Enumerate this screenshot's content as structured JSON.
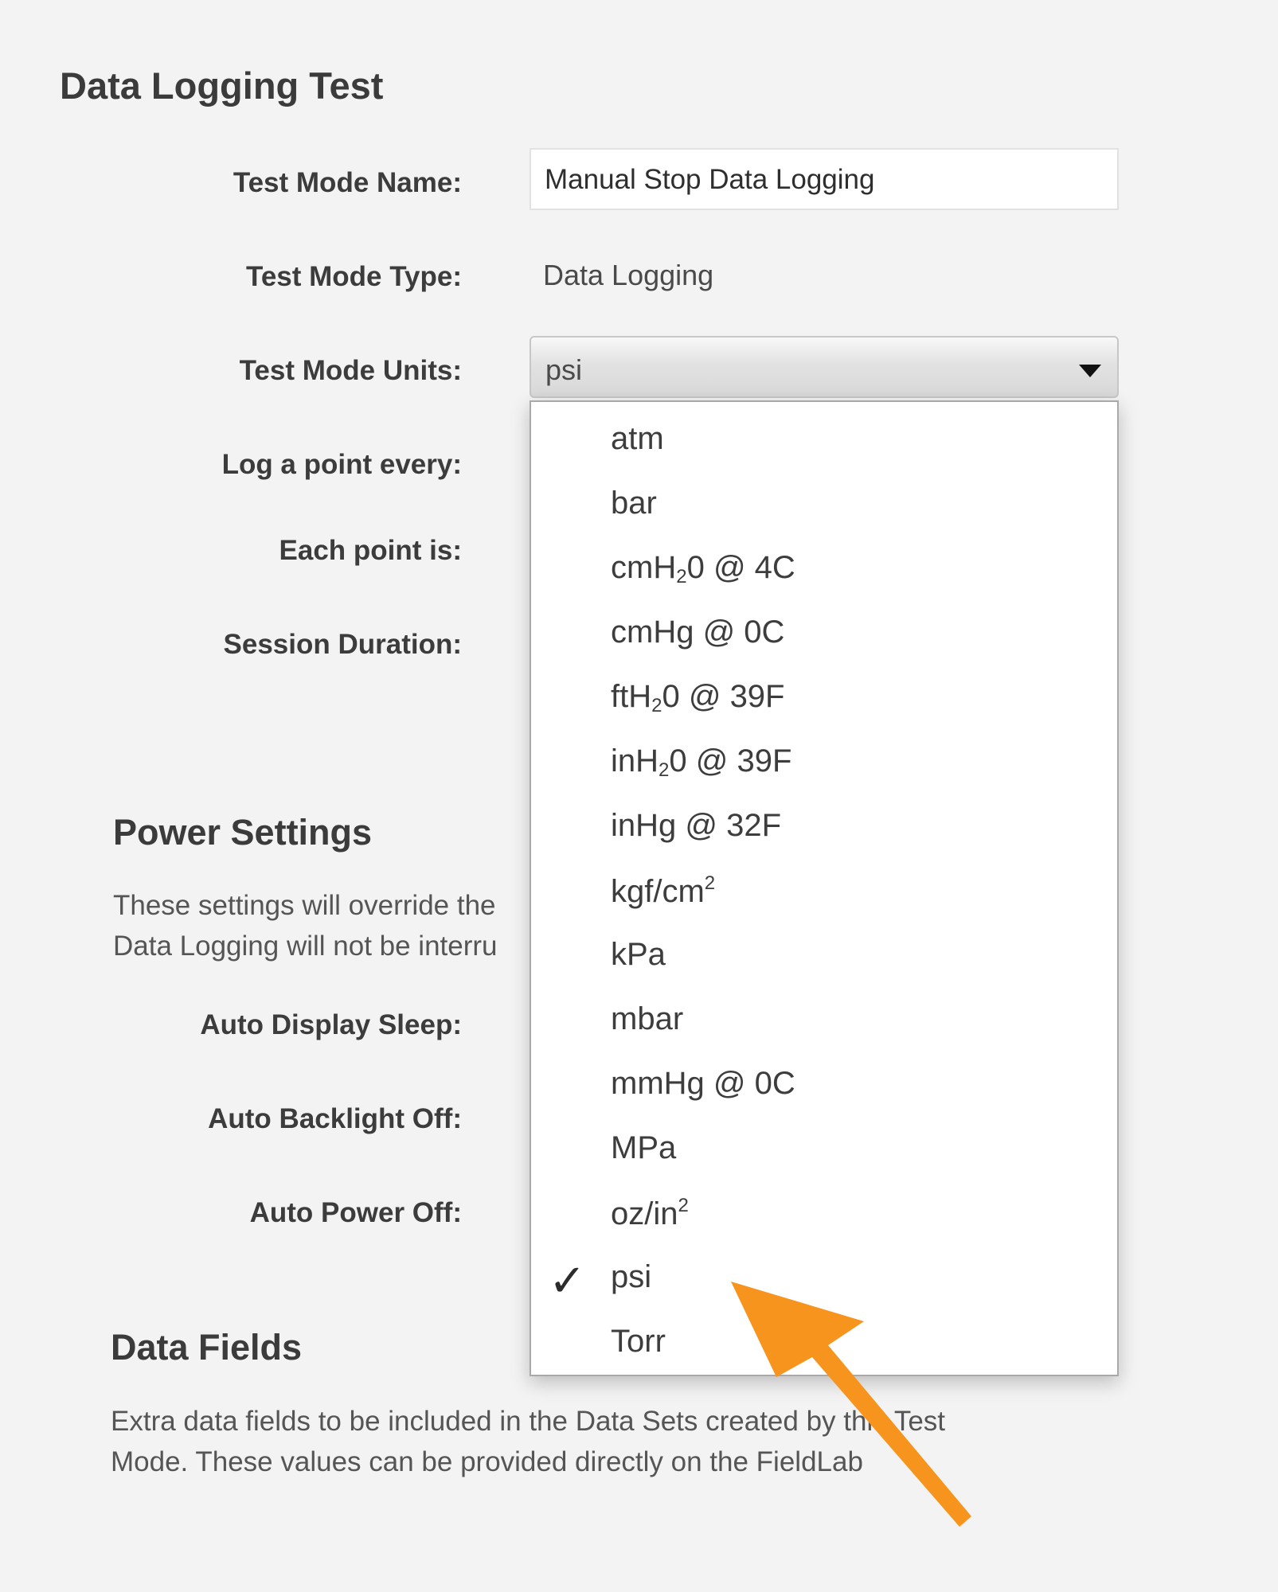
{
  "page": {
    "title": "Data Logging Test"
  },
  "form": {
    "test_mode_name": {
      "label": "Test Mode Name:",
      "value": "Manual Stop Data Logging"
    },
    "test_mode_type": {
      "label": "Test Mode Type:",
      "value": "Data Logging"
    },
    "test_mode_units": {
      "label": "Test Mode Units:",
      "selected": "psi"
    },
    "log_point_every": {
      "label": "Log a point every:"
    },
    "each_point_is": {
      "label": "Each point is:"
    },
    "session_duration": {
      "label": "Session Duration:"
    }
  },
  "power_settings": {
    "title": "Power Settings",
    "description_line1": "These settings will override the",
    "description_line2": "Data Logging will not be interru",
    "auto_display_sleep": {
      "label": "Auto Display Sleep:"
    },
    "auto_backlight_off": {
      "label": "Auto Backlight Off:"
    },
    "auto_power_off": {
      "label": "Auto Power Off:"
    }
  },
  "data_fields": {
    "title": "Data Fields",
    "description_line1": "Extra data fields to be included in the Data Sets created by this Test",
    "description_line2": "Mode. These values can be provided directly on the FieldLab"
  },
  "units_dropdown": {
    "options": [
      {
        "id": "atm",
        "base": "atm"
      },
      {
        "id": "bar",
        "base": "bar"
      },
      {
        "id": "cmh2o",
        "pre": "cmH",
        "sub": "2",
        "post": "0 @ 4C"
      },
      {
        "id": "cmhg",
        "base": "cmHg @ 0C"
      },
      {
        "id": "fth2o",
        "pre": "ftH",
        "sub": "2",
        "post": "0 @ 39F"
      },
      {
        "id": "inh2o",
        "pre": "inH",
        "sub": "2",
        "post": "0 @ 39F"
      },
      {
        "id": "inhg",
        "base": "inHg @ 32F"
      },
      {
        "id": "kgfcm2",
        "pre": "kgf/cm",
        "sup": "2"
      },
      {
        "id": "kpa",
        "base": "kPa"
      },
      {
        "id": "mbar",
        "base": "mbar"
      },
      {
        "id": "mmhg",
        "base": "mmHg @ 0C"
      },
      {
        "id": "mpa",
        "base": "MPa"
      },
      {
        "id": "ozin2",
        "pre": "oz/in",
        "sup": "2"
      },
      {
        "id": "psi",
        "base": "psi",
        "checked": true
      },
      {
        "id": "torr",
        "base": "Torr"
      }
    ],
    "check_glyph": "✓"
  },
  "annotation": {
    "arrow_color": "#f7941d"
  }
}
